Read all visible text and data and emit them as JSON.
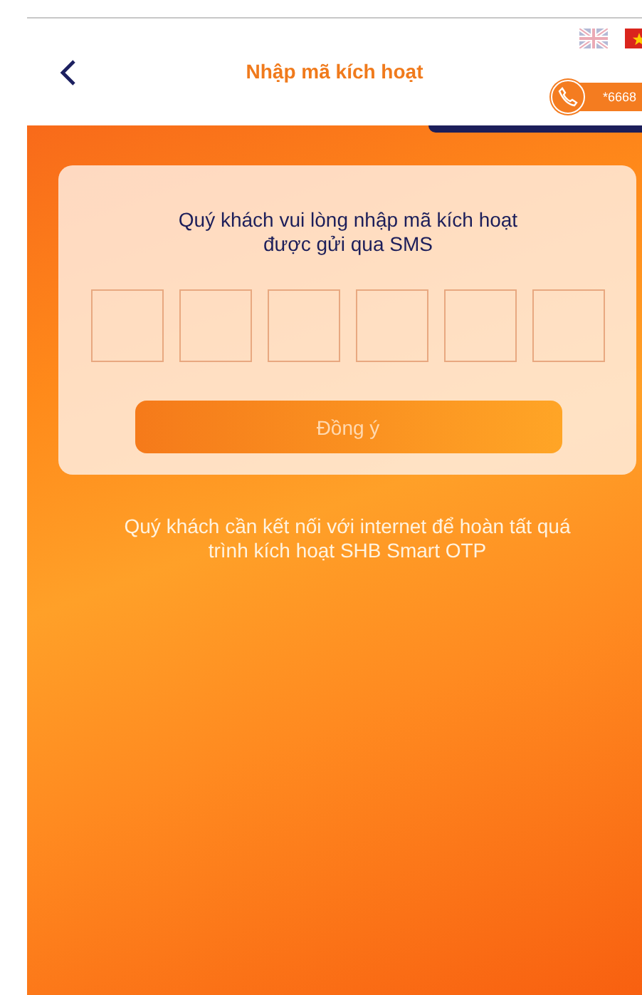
{
  "header": {
    "title": "Nhập mã kích hoạt",
    "hotline": "*6668",
    "languages": [
      {
        "kind": "uk",
        "selected": false
      },
      {
        "kind": "vn",
        "selected": true
      }
    ]
  },
  "card": {
    "prompt": "Quý khách vui lòng nhập mã kích hoạt\nđược gửi qua SMS",
    "code_boxes": [
      {
        "filled": false
      },
      {
        "filled": false
      },
      {
        "filled": false
      },
      {
        "filled": false
      },
      {
        "filled": false
      },
      {
        "filled": false
      }
    ],
    "button": {
      "label": "Đồng ý",
      "disabled": true
    }
  },
  "note": "Quý khách cần kết nối với internet để hoàn tất quá\ntrình kích hoạt SHB Smart OTP"
}
